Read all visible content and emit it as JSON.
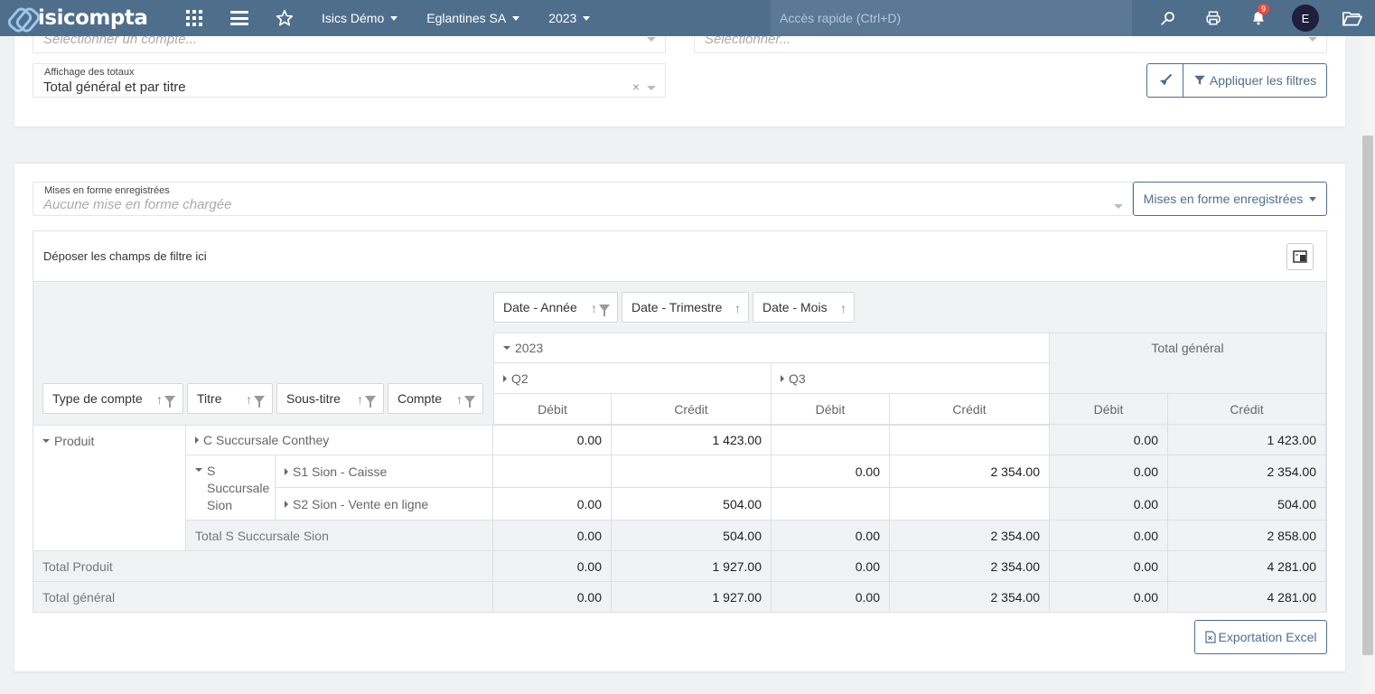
{
  "topbar": {
    "brand": "isicompta",
    "company_menu": "Isics Démo",
    "entity_menu": "Eglantines SA",
    "year_menu": "2023",
    "quick_access_placeholder": "Accès rapide (Ctrl+D)",
    "notification_count": "9",
    "avatar_initial": "E"
  },
  "filters": {
    "account_placeholder": "Sélectionner un compte...",
    "other_placeholder": "Sélectionner...",
    "totals_label": "Affichage des totaux",
    "totals_value": "Total général et par titre",
    "clear_symbol": "×",
    "apply_label": "Appliquer les filtres"
  },
  "layouts": {
    "label": "Mises en forme enregistrées",
    "placeholder": "Aucune mise en forme chargée",
    "button_label": "Mises en forme enregistrées"
  },
  "pivot": {
    "drop_zone": "Déposer les champs de filtre ici",
    "col_fields": [
      "Date - Année",
      "Date - Trimestre",
      "Date - Mois"
    ],
    "row_fields": [
      "Type de compte",
      "Titre",
      "Sous-titre",
      "Compte"
    ],
    "year": "2023",
    "grand_total_header": "Total général",
    "q2": "Q2",
    "q3": "Q3",
    "debit": "Débit",
    "credit": "Crédit",
    "type_produit": "Produit",
    "title_c": "C Succursale Conthey",
    "title_s_lines": [
      "S",
      "Succursale",
      "Sion"
    ],
    "account_s1": "S1 Sion - Caisse",
    "account_s2": "S2 Sion - Vente en ligne",
    "total_s": "Total S Succursale Sion",
    "total_produit": "Total Produit",
    "total_general": "Total général",
    "rows": {
      "c": {
        "q2d": "0.00",
        "q2c": "1 423.00",
        "q3d": "",
        "q3c": "",
        "td": "0.00",
        "tc": "1 423.00"
      },
      "s1": {
        "q2d": "",
        "q2c": "",
        "q3d": "0.00",
        "q3c": "2 354.00",
        "td": "0.00",
        "tc": "2 354.00"
      },
      "s2": {
        "q2d": "0.00",
        "q2c": "504.00",
        "q3d": "",
        "q3c": "",
        "td": "0.00",
        "tc": "504.00"
      },
      "total_s": {
        "q2d": "0.00",
        "q2c": "504.00",
        "q3d": "0.00",
        "q3c": "2 354.00",
        "td": "0.00",
        "tc": "2 858.00"
      },
      "total_p": {
        "q2d": "0.00",
        "q2c": "1 927.00",
        "q3d": "0.00",
        "q3c": "2 354.00",
        "td": "0.00",
        "tc": "4 281.00"
      },
      "total_g": {
        "q2d": "0.00",
        "q2c": "1 927.00",
        "q3d": "0.00",
        "q3c": "2 354.00",
        "td": "0.00",
        "tc": "4 281.00"
      }
    }
  },
  "export_label": "Exportation Excel"
}
